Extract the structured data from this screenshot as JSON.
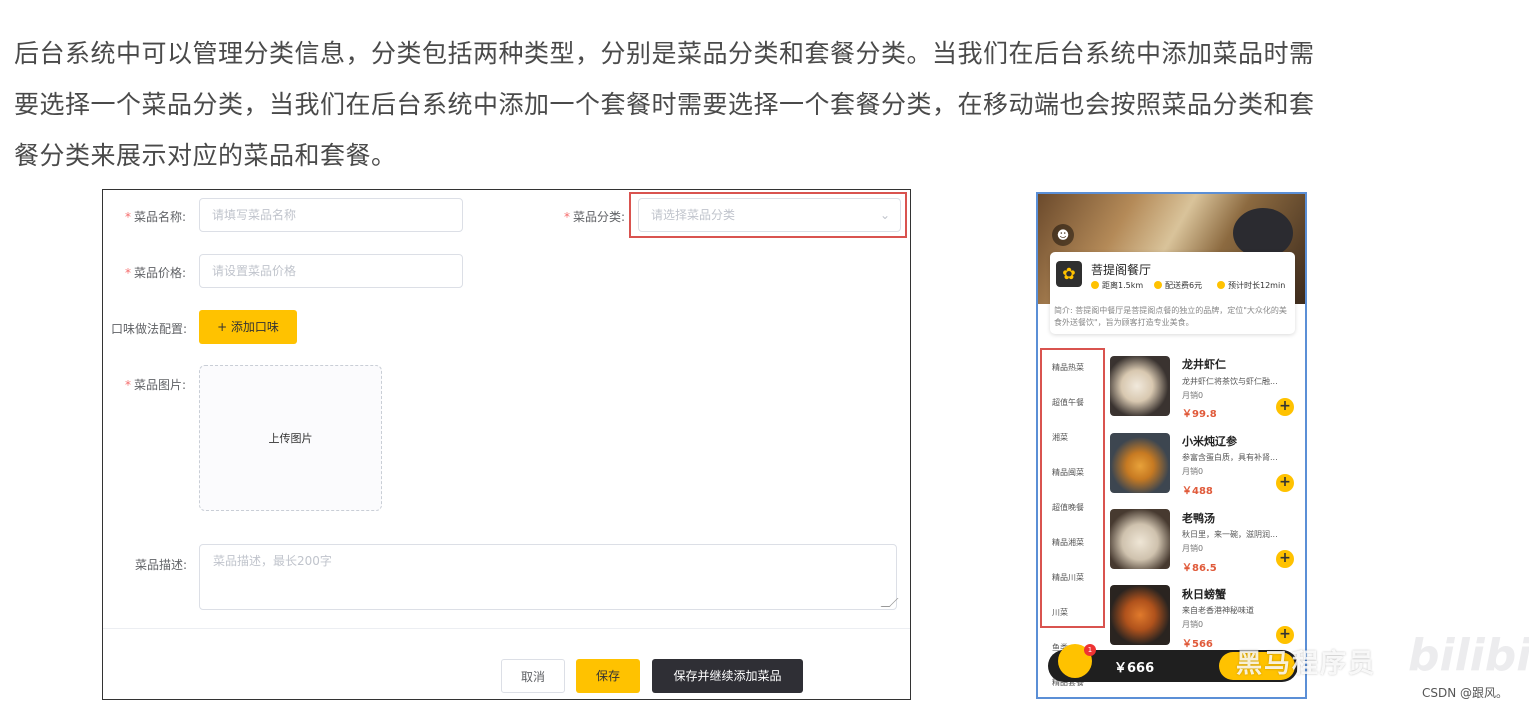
{
  "paragraph": {
    "line1": "后台系统中可以管理分类信息，分类包括两种类型，分别是菜品分类和套餐分类。当我们在后台系统中添加菜品时需",
    "line2": "要选择一个菜品分类，当我们在后台系统中添加一个套餐时需要选择一个套餐分类，在移动端也会按照菜品分类和套",
    "line3": "餐分类来展示对应的菜品和套餐。"
  },
  "form": {
    "required_mark": "*",
    "name_label": "菜品名称:",
    "name_placeholder": "请填写菜品名称",
    "category_label": "菜品分类:",
    "category_placeholder": "请选择菜品分类",
    "price_label": "菜品价格:",
    "price_placeholder": "请设置菜品价格",
    "flavor_label": "口味做法配置:",
    "add_flavor_button": "+ 添加口味",
    "image_label": "菜品图片:",
    "upload_text": "上传图片",
    "desc_label": "菜品描述:",
    "desc_placeholder": "菜品描述，最长200字",
    "cancel_button": "取消",
    "save_button": "保存",
    "save_continue_button": "保存并继续添加菜品",
    "chevron_icon": "chevron-down-icon"
  },
  "phone": {
    "restaurant_name": "菩提阁餐厅",
    "distance": "距离1.5km",
    "delivery_fee": "配送费6元",
    "eta": "预计时长12min",
    "intro": "简介: 菩提阁中餐厅是菩提阁点餐的独立的品牌，定位\"大众化的美食外送餐饮\"，旨为顾客打造专业美食。",
    "categories": [
      "精品热菜",
      "超值午餐",
      "湘菜",
      "精品闽菜",
      "超值晚餐",
      "精品湘菜",
      "精品川菜",
      "川菜",
      "鱼类",
      "精品套餐"
    ],
    "dishes": [
      {
        "name": "龙井虾仁",
        "desc": "龙井虾仁将茶饮与虾仁融...",
        "sales": "月销0",
        "price": "￥99.8"
      },
      {
        "name": "小米炖辽参",
        "desc": "参富含蛋白质，具有补肾...",
        "sales": "月销0",
        "price": "￥488"
      },
      {
        "name": "老鸭汤",
        "desc": "秋日里，来一碗，滋阴润...",
        "sales": "月销0",
        "price": "￥86.5"
      },
      {
        "name": "秋日螃蟹",
        "desc": "来自老香港神秘味道",
        "sales": "月销0",
        "price": "￥566"
      }
    ],
    "cart_total": "￥666",
    "cart_badge": "1",
    "colors": {
      "accent": "#ffc200",
      "price": "#e05a3a",
      "highlight": "#d9534f"
    }
  },
  "watermarks": {
    "channel": "黑马程序员",
    "bilibili": "bilibili",
    "csdn": "CSDN @跟风。"
  }
}
